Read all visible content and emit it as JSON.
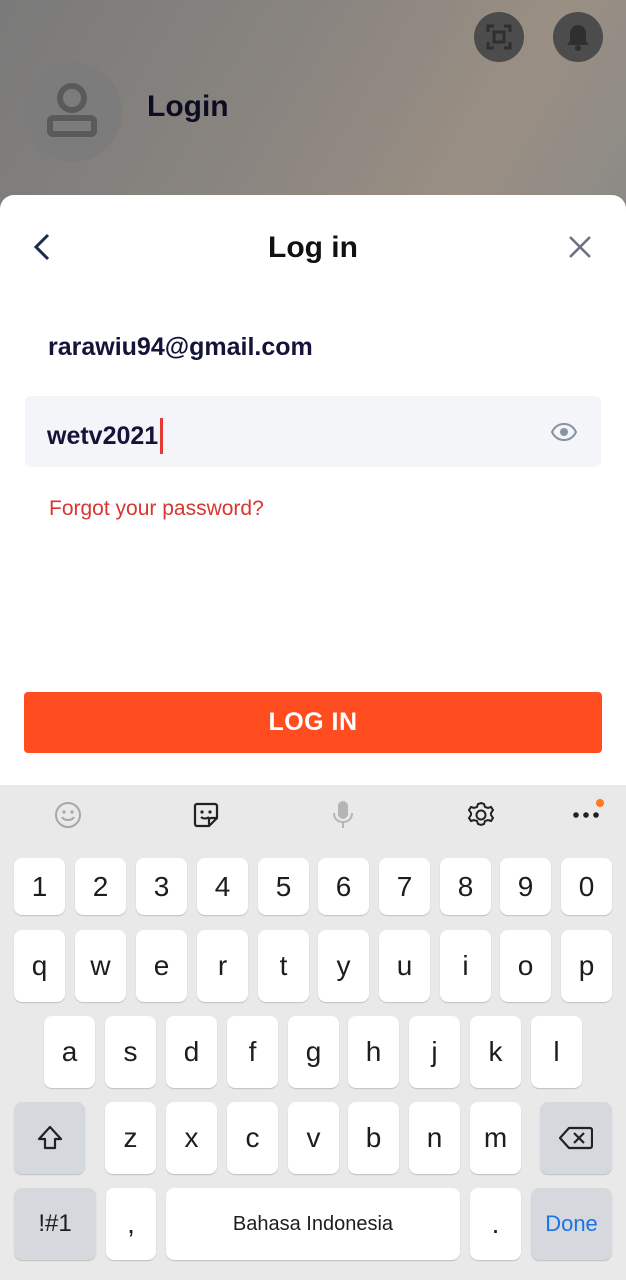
{
  "background": {
    "title": "Login"
  },
  "sheet": {
    "title": "Log in",
    "email_value": "rarawiu94@gmail.com",
    "password_value": "wetv2021",
    "forgot_label": "Forgot your password?",
    "login_button_label": "LOG IN"
  },
  "keyboard": {
    "row_numbers": [
      "1",
      "2",
      "3",
      "4",
      "5",
      "6",
      "7",
      "8",
      "9",
      "0"
    ],
    "row_q": [
      "q",
      "w",
      "e",
      "r",
      "t",
      "y",
      "u",
      "i",
      "o",
      "p"
    ],
    "row_a": [
      "a",
      "s",
      "d",
      "f",
      "g",
      "h",
      "j",
      "k",
      "l"
    ],
    "row_z": [
      "z",
      "x",
      "c",
      "v",
      "b",
      "n",
      "m"
    ],
    "symbols_label": "!#1",
    "comma_label": ",",
    "space_label": "Bahasa Indonesia",
    "period_label": ".",
    "done_label": "Done"
  },
  "colors": {
    "accent": "#ff4d1f",
    "link": "#d8362f",
    "caret": "#e53935",
    "done": "#1a73e8"
  }
}
